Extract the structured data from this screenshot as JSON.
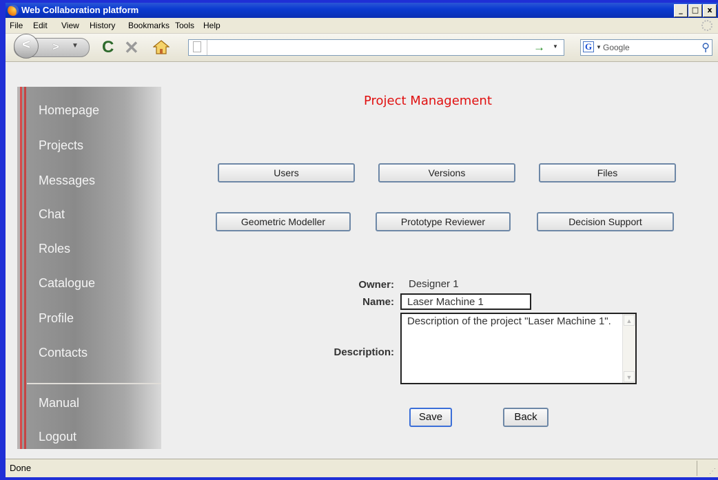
{
  "window": {
    "title": "Web Collaboration platform",
    "min": "_",
    "max": "□",
    "close": "x"
  },
  "menu": [
    "File",
    "Edit",
    "View",
    "History",
    "Bookmarks",
    "Tools",
    "Help"
  ],
  "toolbar": {
    "back": "<",
    "forward": ">",
    "reload": "C",
    "stop": "✕",
    "url": "",
    "search_placeholder": "Google",
    "search_engine": "G"
  },
  "sidebar": {
    "items": [
      "Homepage",
      "Projects",
      "Messages",
      "Chat",
      "Roles",
      "Catalogue",
      "Profile",
      "Contacts"
    ],
    "bottom_items": [
      "Manual",
      "Logout"
    ]
  },
  "page": {
    "title": "Project Management",
    "buttons_row1": [
      "Users",
      "Versions",
      "Files"
    ],
    "buttons_row2": [
      "Geometric Modeller",
      "Prototype Reviewer",
      "Decision Support"
    ],
    "owner_label": "Owner:",
    "owner_value": "Designer 1",
    "name_label": "Name:",
    "name_value": "Laser Machine 1",
    "description_label": "Description:",
    "description_value": "Description of the project \"Laser Machine 1\".",
    "save_label": "Save",
    "back_label": "Back"
  },
  "status": {
    "text": "Done"
  },
  "colors": {
    "title_red": "#e01010",
    "xp_blue": "#0b3bd1",
    "desktop_blue": "#1f2fd6"
  }
}
